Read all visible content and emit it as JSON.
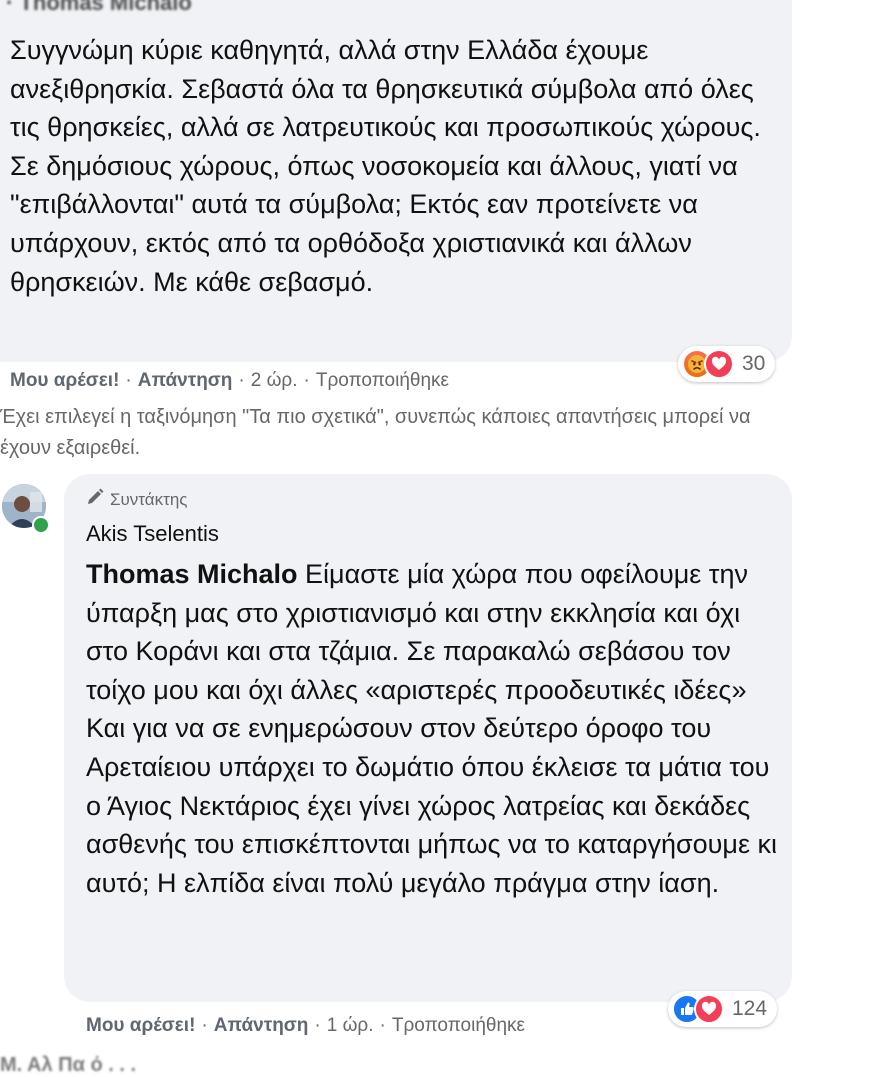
{
  "comment1": {
    "text": "Συγγνώμη κύριε καθηγητά, αλλά στην Ελλάδα έχουμε ανεξιθρησκία. Σεβαστά όλα τα θρησκευτικά σύμβολα από όλες τις θρησκείες, αλλά σε λατρευτικούς και προσωπικούς χώρους. Σε δημόσιους χώρους, όπως νοσοκομεία και άλλους, γιατί να \"επιβάλλονται\" αυτά τα σύμβολα; Εκτός εαν προτείνετε να υπάρχουν, εκτός από τα ορθόδοξα χριστιανικά και άλλων θρησκειών. Με κάθε σεβασμό.",
    "reaction_icons": [
      "angry-icon",
      "love-icon"
    ],
    "reaction_count": "30",
    "like_label": "Μου αρέσει!",
    "reply_label": "Απάντηση",
    "time": "2 ώρ.",
    "edited": "Τροποποιήθηκε"
  },
  "sort_notice": "Έχει επιλεγεί η ταξινόμηση \"Τα πιο σχετικά\", συνεπώς κάποιες απαντήσεις μπορεί να έχουν εξαιρεθεί.",
  "comment2": {
    "badge": "Συντάκτης",
    "author": "Akis Tselentis",
    "mention": "Thomas Michalo",
    "text": "Είμαστε μία χώρα που οφείλουμε την ύπαρξη μας στο χριστιανισμό και στην εκκλησία και όχι στο Κοράνι και στα τζάμια. Σε παρακαλώ σεβάσου τον τοίχο μου και όχι άλλες «αριστερές προοδευτικές ιδέες» Και για να σε ενημερώσουν στον δεύτερο όροφο του Αρεταίειου υπάρχει το δωμάτιο όπου έκλεισε τα μάτια του ο Άγιος Νεκτάριος έχει γίνει χώρος λατρείας και δεκάδες ασθενής του επισκέπτονται μήπως να το καταργήσουμε κι αυτό; Η ελπίδα είναι πολύ μεγάλο πράγμα στην ίαση.",
    "reaction_icons": [
      "like-icon",
      "love-icon"
    ],
    "reaction_count": "124",
    "like_label": "Μου αρέσει!",
    "reply_label": "Απάντηση",
    "time": "1 ώρ.",
    "edited": "Τροποποιήθηκε"
  },
  "colors": {
    "bubble": "#f0f2f5",
    "meta_text": "#65676b",
    "like_blue": "#1877f2",
    "love_red": "#f33e58",
    "angry_orange": "#e9710f",
    "online_green": "#31a24c"
  }
}
